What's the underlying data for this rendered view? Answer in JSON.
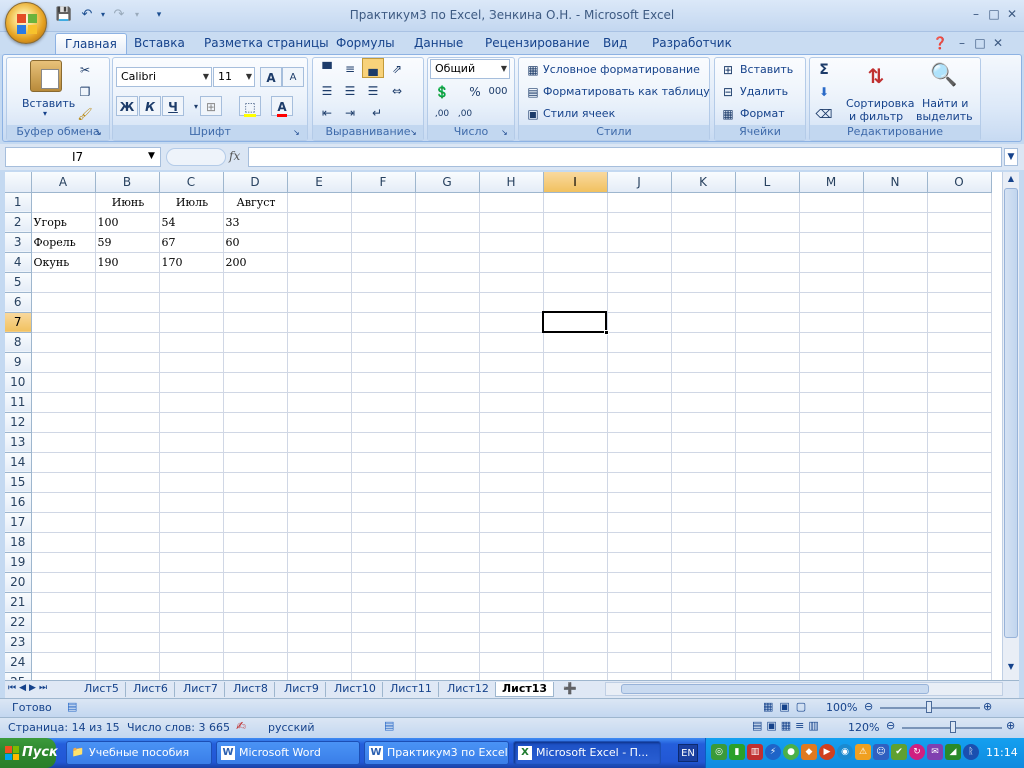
{
  "window": {
    "title": "Практикум3 по Excel, Зенкина О.Н. - Microsoft Excel",
    "minimize_icon": "minimize-icon",
    "restore_icon": "restore-icon",
    "close_icon": "close-icon"
  },
  "qat": {
    "save": "save-icon",
    "undo": "undo-icon",
    "redo": "redo-icon",
    "more": "qat-more-icon"
  },
  "tabs": [
    "Главная",
    "Вставка",
    "Разметка страницы",
    "Формулы",
    "Данные",
    "Рецензирование",
    "Вид",
    "Разработчик"
  ],
  "ribbon": {
    "clipboard": {
      "label": "Буфер обмена",
      "paste": "Вставить"
    },
    "font": {
      "label": "Шрифт",
      "name": "Calibri",
      "size": "11",
      "bold": "Ж",
      "italic": "К",
      "underline": "Ч",
      "grow": "A",
      "shrink": "A"
    },
    "alignment": {
      "label": "Выравнивание"
    },
    "number": {
      "label": "Число",
      "format": "Общий",
      "percent": "%",
      "thousands": "000",
      "inc_decimal": ",00",
      "dec_decimal": ",00"
    },
    "styles": {
      "label": "Стили",
      "conditional": "Условное форматирование",
      "as_table": "Форматировать как таблицу",
      "cell_styles": "Стили ячеек"
    },
    "cells": {
      "label": "Ячейки",
      "insert": "Вставить",
      "delete": "Удалить",
      "format": "Формат"
    },
    "editing": {
      "label": "Редактирование",
      "sigma": "Σ",
      "sort_l1": "Сортировка",
      "sort_l2": "и фильтр",
      "find_l1": "Найти и",
      "find_l2": "выделить"
    }
  },
  "formula_bar": {
    "name_box": "I7",
    "fx": "fx",
    "value": ""
  },
  "grid": {
    "columns": [
      "A",
      "B",
      "C",
      "D",
      "E",
      "F",
      "G",
      "H",
      "I",
      "J",
      "K",
      "L",
      "M",
      "N",
      "O"
    ],
    "selected_column": "I",
    "selected_row": 7,
    "rows": [
      [
        "",
        "Июнь",
        "Июль",
        "Август"
      ],
      [
        "Угорь",
        "100",
        "54",
        "33"
      ],
      [
        "Форель",
        "59",
        "67",
        "60"
      ],
      [
        "Окунь",
        "190",
        "170",
        "200"
      ]
    ],
    "row_count": 25
  },
  "sheets": {
    "tabs": [
      "Лист5",
      "Лист6",
      "Лист7",
      "Лист8",
      "Лист9",
      "Лист10",
      "Лист11",
      "Лист12",
      "Лист13"
    ],
    "active": "Лист13"
  },
  "status1": {
    "ready": "Готово",
    "zoom": "100%"
  },
  "status2": {
    "page": "Страница: 14 из 15",
    "words": "Число слов: 3 665",
    "language": "русский",
    "zoom": "120%"
  },
  "taskbar": {
    "start": "Пуск",
    "items": [
      "Учебные пособия",
      "Microsoft Word",
      "Практикум3 по Excel...",
      "Microsoft Excel - П..."
    ],
    "lang": "EN",
    "clock": "11:14"
  },
  "colors": {
    "accent": "#15428b",
    "selected_header": "#f1c15f",
    "taskbar": "#245edb"
  }
}
